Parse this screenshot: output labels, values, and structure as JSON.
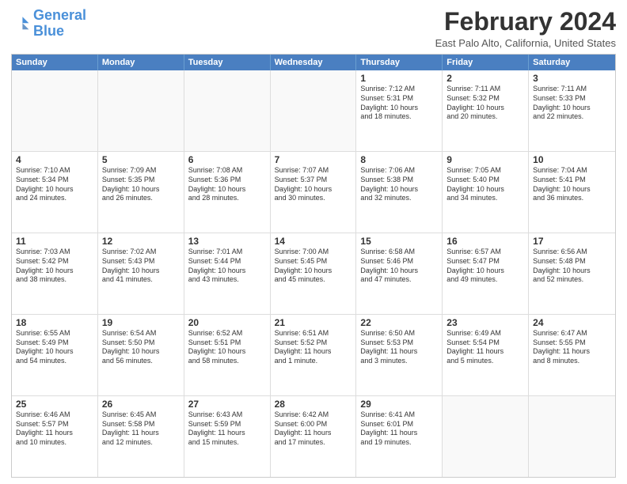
{
  "logo": {
    "line1": "General",
    "line2": "Blue"
  },
  "title": "February 2024",
  "location": "East Palo Alto, California, United States",
  "days_header": [
    "Sunday",
    "Monday",
    "Tuesday",
    "Wednesday",
    "Thursday",
    "Friday",
    "Saturday"
  ],
  "weeks": [
    [
      {
        "day": "",
        "text": ""
      },
      {
        "day": "",
        "text": ""
      },
      {
        "day": "",
        "text": ""
      },
      {
        "day": "",
        "text": ""
      },
      {
        "day": "1",
        "text": "Sunrise: 7:12 AM\nSunset: 5:31 PM\nDaylight: 10 hours\nand 18 minutes."
      },
      {
        "day": "2",
        "text": "Sunrise: 7:11 AM\nSunset: 5:32 PM\nDaylight: 10 hours\nand 20 minutes."
      },
      {
        "day": "3",
        "text": "Sunrise: 7:11 AM\nSunset: 5:33 PM\nDaylight: 10 hours\nand 22 minutes."
      }
    ],
    [
      {
        "day": "4",
        "text": "Sunrise: 7:10 AM\nSunset: 5:34 PM\nDaylight: 10 hours\nand 24 minutes."
      },
      {
        "day": "5",
        "text": "Sunrise: 7:09 AM\nSunset: 5:35 PM\nDaylight: 10 hours\nand 26 minutes."
      },
      {
        "day": "6",
        "text": "Sunrise: 7:08 AM\nSunset: 5:36 PM\nDaylight: 10 hours\nand 28 minutes."
      },
      {
        "day": "7",
        "text": "Sunrise: 7:07 AM\nSunset: 5:37 PM\nDaylight: 10 hours\nand 30 minutes."
      },
      {
        "day": "8",
        "text": "Sunrise: 7:06 AM\nSunset: 5:38 PM\nDaylight: 10 hours\nand 32 minutes."
      },
      {
        "day": "9",
        "text": "Sunrise: 7:05 AM\nSunset: 5:40 PM\nDaylight: 10 hours\nand 34 minutes."
      },
      {
        "day": "10",
        "text": "Sunrise: 7:04 AM\nSunset: 5:41 PM\nDaylight: 10 hours\nand 36 minutes."
      }
    ],
    [
      {
        "day": "11",
        "text": "Sunrise: 7:03 AM\nSunset: 5:42 PM\nDaylight: 10 hours\nand 38 minutes."
      },
      {
        "day": "12",
        "text": "Sunrise: 7:02 AM\nSunset: 5:43 PM\nDaylight: 10 hours\nand 41 minutes."
      },
      {
        "day": "13",
        "text": "Sunrise: 7:01 AM\nSunset: 5:44 PM\nDaylight: 10 hours\nand 43 minutes."
      },
      {
        "day": "14",
        "text": "Sunrise: 7:00 AM\nSunset: 5:45 PM\nDaylight: 10 hours\nand 45 minutes."
      },
      {
        "day": "15",
        "text": "Sunrise: 6:58 AM\nSunset: 5:46 PM\nDaylight: 10 hours\nand 47 minutes."
      },
      {
        "day": "16",
        "text": "Sunrise: 6:57 AM\nSunset: 5:47 PM\nDaylight: 10 hours\nand 49 minutes."
      },
      {
        "day": "17",
        "text": "Sunrise: 6:56 AM\nSunset: 5:48 PM\nDaylight: 10 hours\nand 52 minutes."
      }
    ],
    [
      {
        "day": "18",
        "text": "Sunrise: 6:55 AM\nSunset: 5:49 PM\nDaylight: 10 hours\nand 54 minutes."
      },
      {
        "day": "19",
        "text": "Sunrise: 6:54 AM\nSunset: 5:50 PM\nDaylight: 10 hours\nand 56 minutes."
      },
      {
        "day": "20",
        "text": "Sunrise: 6:52 AM\nSunset: 5:51 PM\nDaylight: 10 hours\nand 58 minutes."
      },
      {
        "day": "21",
        "text": "Sunrise: 6:51 AM\nSunset: 5:52 PM\nDaylight: 11 hours\nand 1 minute."
      },
      {
        "day": "22",
        "text": "Sunrise: 6:50 AM\nSunset: 5:53 PM\nDaylight: 11 hours\nand 3 minutes."
      },
      {
        "day": "23",
        "text": "Sunrise: 6:49 AM\nSunset: 5:54 PM\nDaylight: 11 hours\nand 5 minutes."
      },
      {
        "day": "24",
        "text": "Sunrise: 6:47 AM\nSunset: 5:55 PM\nDaylight: 11 hours\nand 8 minutes."
      }
    ],
    [
      {
        "day": "25",
        "text": "Sunrise: 6:46 AM\nSunset: 5:57 PM\nDaylight: 11 hours\nand 10 minutes."
      },
      {
        "day": "26",
        "text": "Sunrise: 6:45 AM\nSunset: 5:58 PM\nDaylight: 11 hours\nand 12 minutes."
      },
      {
        "day": "27",
        "text": "Sunrise: 6:43 AM\nSunset: 5:59 PM\nDaylight: 11 hours\nand 15 minutes."
      },
      {
        "day": "28",
        "text": "Sunrise: 6:42 AM\nSunset: 6:00 PM\nDaylight: 11 hours\nand 17 minutes."
      },
      {
        "day": "29",
        "text": "Sunrise: 6:41 AM\nSunset: 6:01 PM\nDaylight: 11 hours\nand 19 minutes."
      },
      {
        "day": "",
        "text": ""
      },
      {
        "day": "",
        "text": ""
      }
    ]
  ]
}
